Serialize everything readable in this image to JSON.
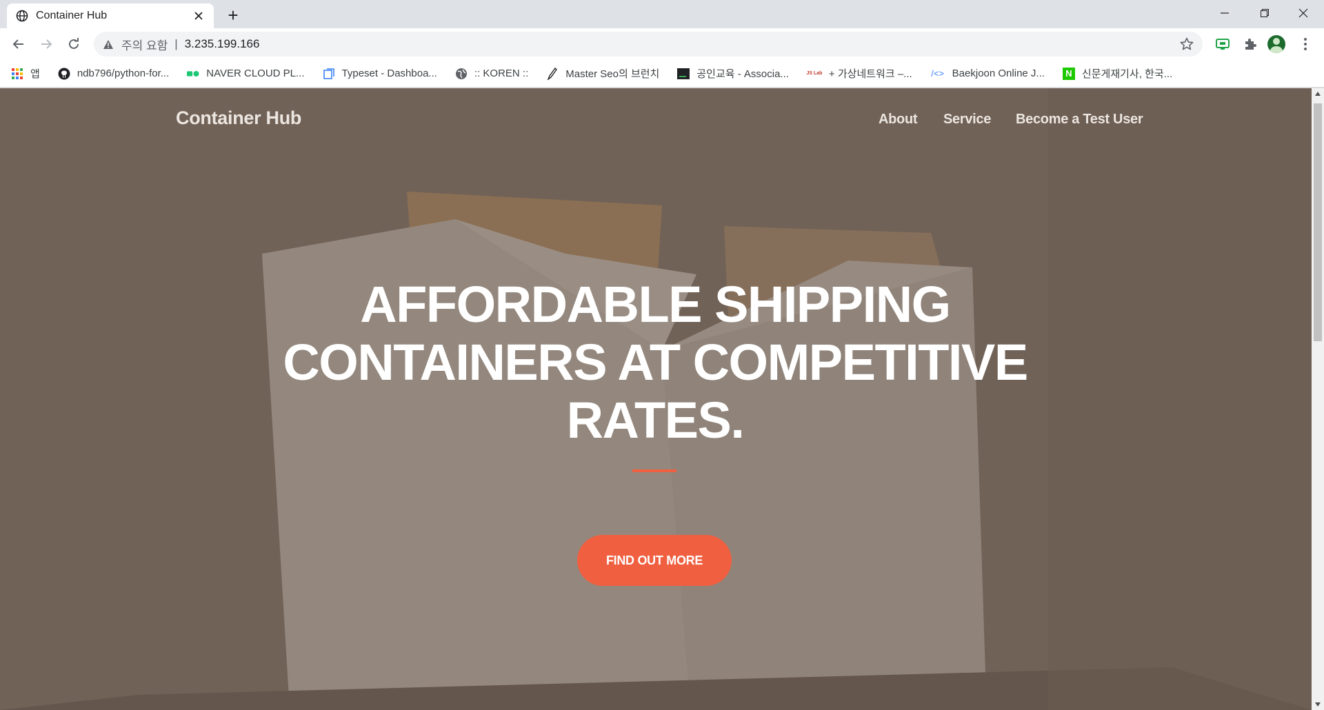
{
  "browser": {
    "tab": {
      "title": "Container Hub",
      "icon": "globe-icon"
    },
    "new_tab_label": "+",
    "address_bar": {
      "security_label": "주의 요함",
      "separator": "|",
      "url": "3.235.199.166"
    }
  },
  "bookmarks": {
    "items": [
      {
        "label": "앱",
        "icon": "apps-grid-icon"
      },
      {
        "label": "ndb796/python-for...",
        "icon": "github-icon"
      },
      {
        "label": "NAVER CLOUD PL...",
        "icon": "naver-cloud-icon"
      },
      {
        "label": "Typeset - Dashboa...",
        "icon": "typeset-icon"
      },
      {
        "label": ":: KOREN ::",
        "icon": "globe-icon"
      },
      {
        "label": "Master Seo의 브런치",
        "icon": "brunch-pen-icon"
      },
      {
        "label": "공인교육 - Associa...",
        "icon": "terminal-icon"
      },
      {
        "label": "+ 가상네트워크 –...",
        "icon": "lab-icon",
        "icon_text": "JS Lab"
      },
      {
        "label": "Baekjoon Online J...",
        "icon": "code-icon",
        "icon_text": "/<>"
      },
      {
        "label": "신문게재기사, 한국...",
        "icon": "naver-icon",
        "icon_text": "N"
      }
    ]
  },
  "site": {
    "brand": "Container Hub",
    "nav": {
      "about": "About",
      "service": "Service",
      "test_user": "Become a Test User"
    },
    "hero": {
      "heading": "AFFORDABLE SHIPPING CONTAINERS AT COMPETITIVE RATES.",
      "cta": "FIND OUT MORE"
    }
  },
  "colors": {
    "accent": "#f05f40",
    "chrome_bg": "#dee1e6",
    "hero_overlay": "#5c4d42"
  }
}
